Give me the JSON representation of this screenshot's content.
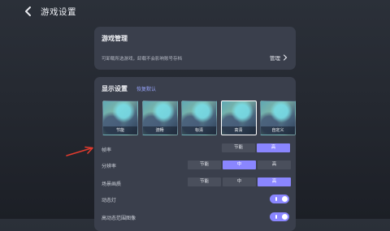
{
  "header": {
    "title": "游戏设置"
  },
  "manage": {
    "title": "游戏管理",
    "desc": "可卸载所选游戏，卸载不会影响账号存档",
    "button_label": "管理"
  },
  "display": {
    "title": "显示设置",
    "restore_label": "恢复默认",
    "presets": [
      {
        "label": "节能"
      },
      {
        "label": "流畅"
      },
      {
        "label": "标清"
      },
      {
        "label": "高清"
      },
      {
        "label": "自定义"
      }
    ],
    "selected_preset": "高清",
    "rows": {
      "fps": {
        "label": "帧率",
        "options": [
          "节能",
          "高"
        ],
        "selected": "高"
      },
      "resolution": {
        "label": "分辨率",
        "options": [
          "节能",
          "中",
          "高"
        ],
        "selected": "中"
      },
      "scene": {
        "label": "场景画质",
        "options": [
          "节能",
          "中",
          "高"
        ],
        "selected": "高"
      },
      "dynamic_light": {
        "label": "动态灯",
        "enabled": true
      },
      "hdr": {
        "label": "高动态范围图像",
        "enabled": true
      }
    }
  },
  "colors": {
    "accent": "#8a86ff",
    "card_bg": "#3a3f4c",
    "arrow": "#e23b2e"
  }
}
